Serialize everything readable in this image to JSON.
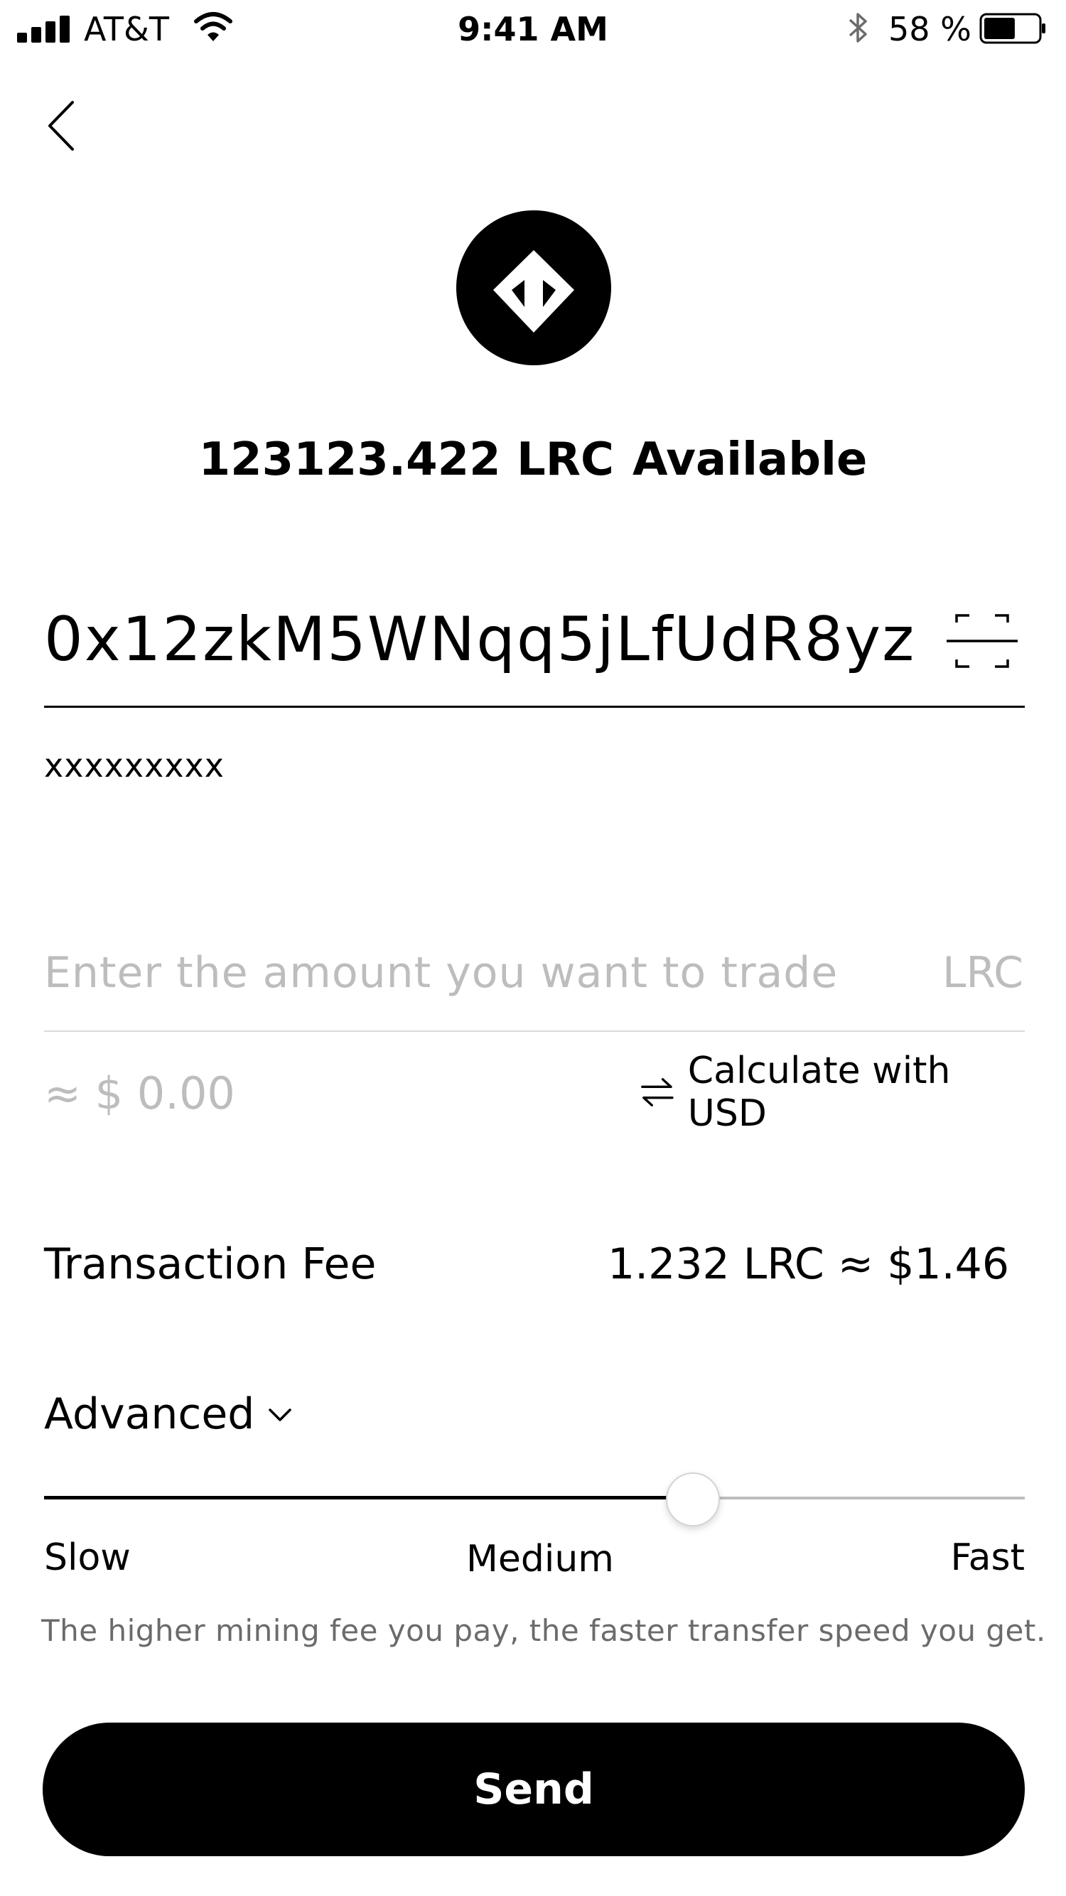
{
  "status_bar": {
    "carrier": "AT&T",
    "time": "9:41 AM",
    "battery_percent": "58 %",
    "signal_bars": 4,
    "battery_level": 0.58,
    "icons": [
      "signal-icon",
      "wifi-icon",
      "bluetooth-icon",
      "battery-icon"
    ]
  },
  "header": {
    "back_icon": "chevron-left-icon"
  },
  "token": {
    "logo_icon": "loopring-logo-icon",
    "available_amount": "123123.422 LRC",
    "available_label": "Available"
  },
  "recipient": {
    "address": "0x12zkM5WNqq5jLfUdR8yz",
    "scan_icon": "qr-scan-icon",
    "note": "xxxxxxxxx"
  },
  "amount": {
    "placeholder": "Enter the amount you want to trade",
    "unit": "LRC",
    "usd_estimate": "≈ $ 0.00",
    "calc_label": "Calculate with USD",
    "swap_icon": "swap-arrows-icon"
  },
  "fee": {
    "label": "Transaction Fee",
    "value": "1.232 LRC ≈ $1.46"
  },
  "advanced": {
    "label": "Advanced",
    "toggle_icon": "chevron-down-icon",
    "speed_level": 0.66,
    "speed_labels": {
      "slow": "Slow",
      "medium": "Medium",
      "fast": "Fast"
    },
    "hint": "The higher mining fee you pay, the faster transfer speed you get."
  },
  "actions": {
    "send_label": "Send"
  },
  "colors": {
    "primary": "#000000",
    "placeholder": "#bdbdbd",
    "hint": "#6b6b6b",
    "divider": "#d9d9d9"
  }
}
